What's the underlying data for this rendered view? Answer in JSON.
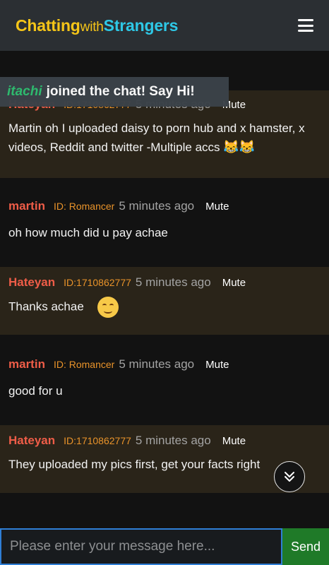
{
  "header": {
    "logo": {
      "part1": "Chatting",
      "part2": "with",
      "part3": "Strangers"
    },
    "menu_icon": "hamburger-menu-icon"
  },
  "toast": {
    "username": "itachi",
    "message": "joined the chat! Say Hi!"
  },
  "messages": [
    {
      "name": "Hateyan",
      "id": "ID:1710862777",
      "time": "5 minutes ago",
      "mute": "Mute",
      "text": "Martin oh I uploaded daisy to porn hub and x hamster, x videos, Reddit and twitter -Multiple accs",
      "emoji": "😹😹"
    },
    {
      "name": "martin",
      "id": "ID: Romancer",
      "time": "5 minutes ago",
      "mute": "Mute",
      "text": "oh how much did u pay achae"
    },
    {
      "name": "Hateyan",
      "id": "ID:1710862777",
      "time": "5 minutes ago",
      "mute": "Mute",
      "text": "Thanks achae",
      "emoji": "smiling-face-emoji"
    },
    {
      "name": "martin",
      "id": "ID: Romancer",
      "time": "5 minutes ago",
      "mute": "Mute",
      "text": "good for u"
    },
    {
      "name": "Hateyan",
      "id": "ID:1710862777",
      "time": "5 minutes ago",
      "mute": "Mute",
      "text": "They uploaded my pics first, get your facts right"
    }
  ],
  "scroll_button": {
    "icon": "double-chevron-down-icon"
  },
  "composer": {
    "placeholder": "Please enter your message here...",
    "value": "",
    "send_label": "Send"
  },
  "colors": {
    "name": "#ef5d48",
    "id": "#e9932a",
    "alt_row": "#2a2419",
    "send": "#1f7a28",
    "accent": "#2ec8e6"
  }
}
